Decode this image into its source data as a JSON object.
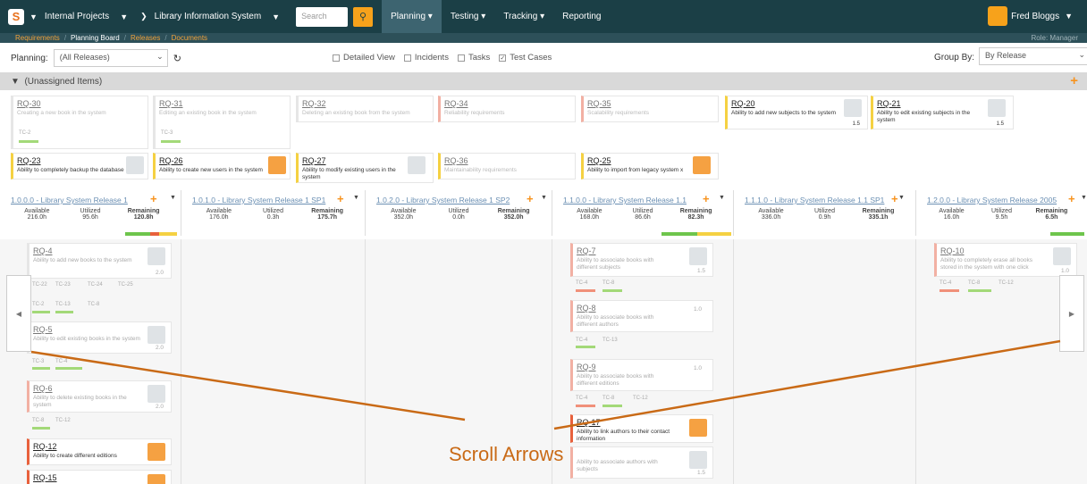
{
  "topnav": {
    "projects": "Internal Projects",
    "product": "Library Information System",
    "search_placeholder": "Search",
    "tabs": [
      "Planning",
      "Testing",
      "Tracking",
      "Reporting"
    ],
    "user": "Fred Bloggs"
  },
  "subnav": {
    "items": [
      "Requirements",
      "Planning Board",
      "Releases",
      "Documents"
    ],
    "role": "Role: Manager"
  },
  "filters": {
    "planning_label": "Planning:",
    "planning_value": "(All Releases)",
    "options": [
      "Detailed View",
      "Incidents",
      "Tasks",
      "Test Cases"
    ],
    "group_label": "Group By:",
    "group_value": "By Release"
  },
  "unassigned": {
    "title": "(Unassigned Items)",
    "cards": [
      {
        "id": "RQ-30",
        "desc": "Creating a new book in the system",
        "tc": "TC-2"
      },
      {
        "id": "RQ-31",
        "desc": "Editing an existing book in the system",
        "tc": "TC-3"
      },
      {
        "id": "RQ-32",
        "desc": "Deleting an existing book from the system"
      },
      {
        "id": "RQ-34",
        "desc": "Reliability requirements"
      },
      {
        "id": "RQ-35",
        "desc": "Scalability requirements"
      },
      {
        "id": "RQ-20",
        "desc": "Ability to add new subjects to the system",
        "est": "1.5"
      },
      {
        "id": "RQ-21",
        "desc": "Ability to edit existing subjects in the system",
        "est": "1.5"
      },
      {
        "id": "RQ-23",
        "desc": "Ability to completely backup the database"
      },
      {
        "id": "RQ-26",
        "desc": "Ability to create new users in the system"
      },
      {
        "id": "RQ-27",
        "desc": "Ability to modify existing users in the system"
      },
      {
        "id": "RQ-36",
        "desc": "Maintainability requirements"
      },
      {
        "id": "RQ-25",
        "desc": "Ability to import from legacy system x"
      }
    ]
  },
  "stat_labels": {
    "available": "Available",
    "utilized": "Utilized",
    "remaining": "Remaining"
  },
  "releases": [
    {
      "title": "1.0.0.0 - Library System Release 1",
      "available": "216.0h",
      "utilized": "95.6h",
      "remaining": "120.8h"
    },
    {
      "title": "1.0.1.0 - Library System Release 1 SP1",
      "available": "176.0h",
      "utilized": "0.3h",
      "remaining": "175.7h"
    },
    {
      "title": "1.0.2.0 - Library System Release 1 SP2",
      "available": "352.0h",
      "utilized": "0.0h",
      "remaining": "352.0h"
    },
    {
      "title": "1.1.0.0 - Library System Release 1.1",
      "available": "168.0h",
      "utilized": "86.6h",
      "remaining": "82.3h"
    },
    {
      "title": "1.1.1.0 - Library System Release 1.1 SP1",
      "available": "336.0h",
      "utilized": "0.9h",
      "remaining": "335.1h"
    },
    {
      "title": "1.2.0.0 - Library System Release 2005",
      "available": "16.0h",
      "utilized": "9.5h",
      "remaining": "6.5h"
    }
  ],
  "board": {
    "c1": [
      {
        "id": "RQ-4",
        "desc": "Ability to add new books to the system",
        "est": "2.0",
        "tcs": [
          "TC-22",
          "TC-23",
          "TC-24",
          "TC-25",
          "TC-2",
          "TC-13",
          "TC-8"
        ]
      },
      {
        "id": "RQ-5",
        "desc": "Ability to edit existing books in the system",
        "est": "2.0",
        "tcs": [
          "TC-3",
          "TC-4"
        ]
      },
      {
        "id": "RQ-6",
        "desc": "Ability to delete existing books in the system",
        "est": "2.0",
        "tcs": [
          "TC-8",
          "TC-12"
        ]
      },
      {
        "id": "RQ-12",
        "desc": "Ability to create different editions"
      },
      {
        "id": "RQ-15"
      }
    ],
    "c4": [
      {
        "id": "RQ-7",
        "desc": "Ability to associate books with different subjects",
        "est": "1.5",
        "tcs": [
          "TC-4",
          "TC-8"
        ]
      },
      {
        "id": "RQ-8",
        "desc": "Ability to associate books with different authors",
        "est": "1.0",
        "tcs": [
          "TC-4",
          "TC-13"
        ]
      },
      {
        "id": "RQ-9",
        "desc": "Ability to associate books with different editions",
        "est": "1.0",
        "tcs": [
          "TC-4",
          "TC-8",
          "TC-12"
        ]
      },
      {
        "id": "RQ-17",
        "desc": "Ability to link authors to their contact information"
      },
      {
        "desc": "Ability to associate authors with subjects",
        "est": "1.5"
      }
    ],
    "c6": [
      {
        "id": "RQ-10",
        "desc": "Ability to completely erase all books stored in the system with one click",
        "est": "1.0",
        "tcs": [
          "TC-4",
          "TC-8",
          "TC-12"
        ]
      }
    ]
  },
  "annotation": "Scroll Arrows"
}
